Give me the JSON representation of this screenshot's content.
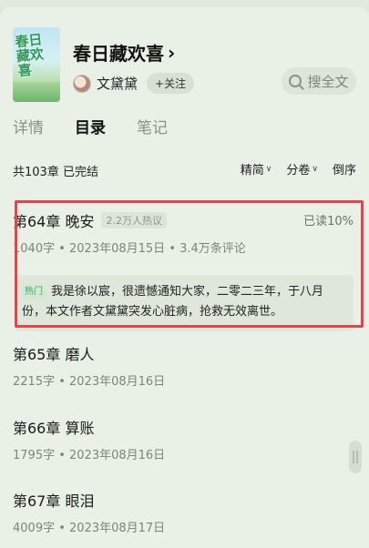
{
  "book": {
    "title": "春日藏欢喜",
    "cover_text": "春日藏欢喜",
    "author": "文黛黛",
    "follow_label": "+关注"
  },
  "search": {
    "label": "搜全文"
  },
  "tabs": [
    {
      "label": "详情",
      "active": false
    },
    {
      "label": "目录",
      "active": true
    },
    {
      "label": "笔记",
      "active": false
    }
  ],
  "catalog": {
    "summary": "共103章 已完结",
    "controls": [
      "精简",
      "分卷",
      "倒序"
    ]
  },
  "chapters": [
    {
      "title": "第64章 晚安",
      "hot_tag": "2.2万人热议",
      "meta": "1040字 • 2023年08月15日 • 3.4万条评论",
      "read_progress": "已读10%",
      "hot_badge": "热门",
      "hot_comment": "我是徐以宸，很遗憾通知大家，二零二三年，于八月份，本文作者文黛黛突发心脏病，抢救无效离世。"
    },
    {
      "title": "第65章 磨人",
      "meta": "2215字 • 2023年08月16日"
    },
    {
      "title": "第66章 算账",
      "meta": "1795字 • 2023年08月16日"
    },
    {
      "title": "第67章 眼泪",
      "meta": "4009字 • 2023年08月17日"
    }
  ],
  "colors": {
    "background": "#e9f0e5",
    "highlight_border": "#e9424a",
    "accent_green": "#3fa25d"
  }
}
